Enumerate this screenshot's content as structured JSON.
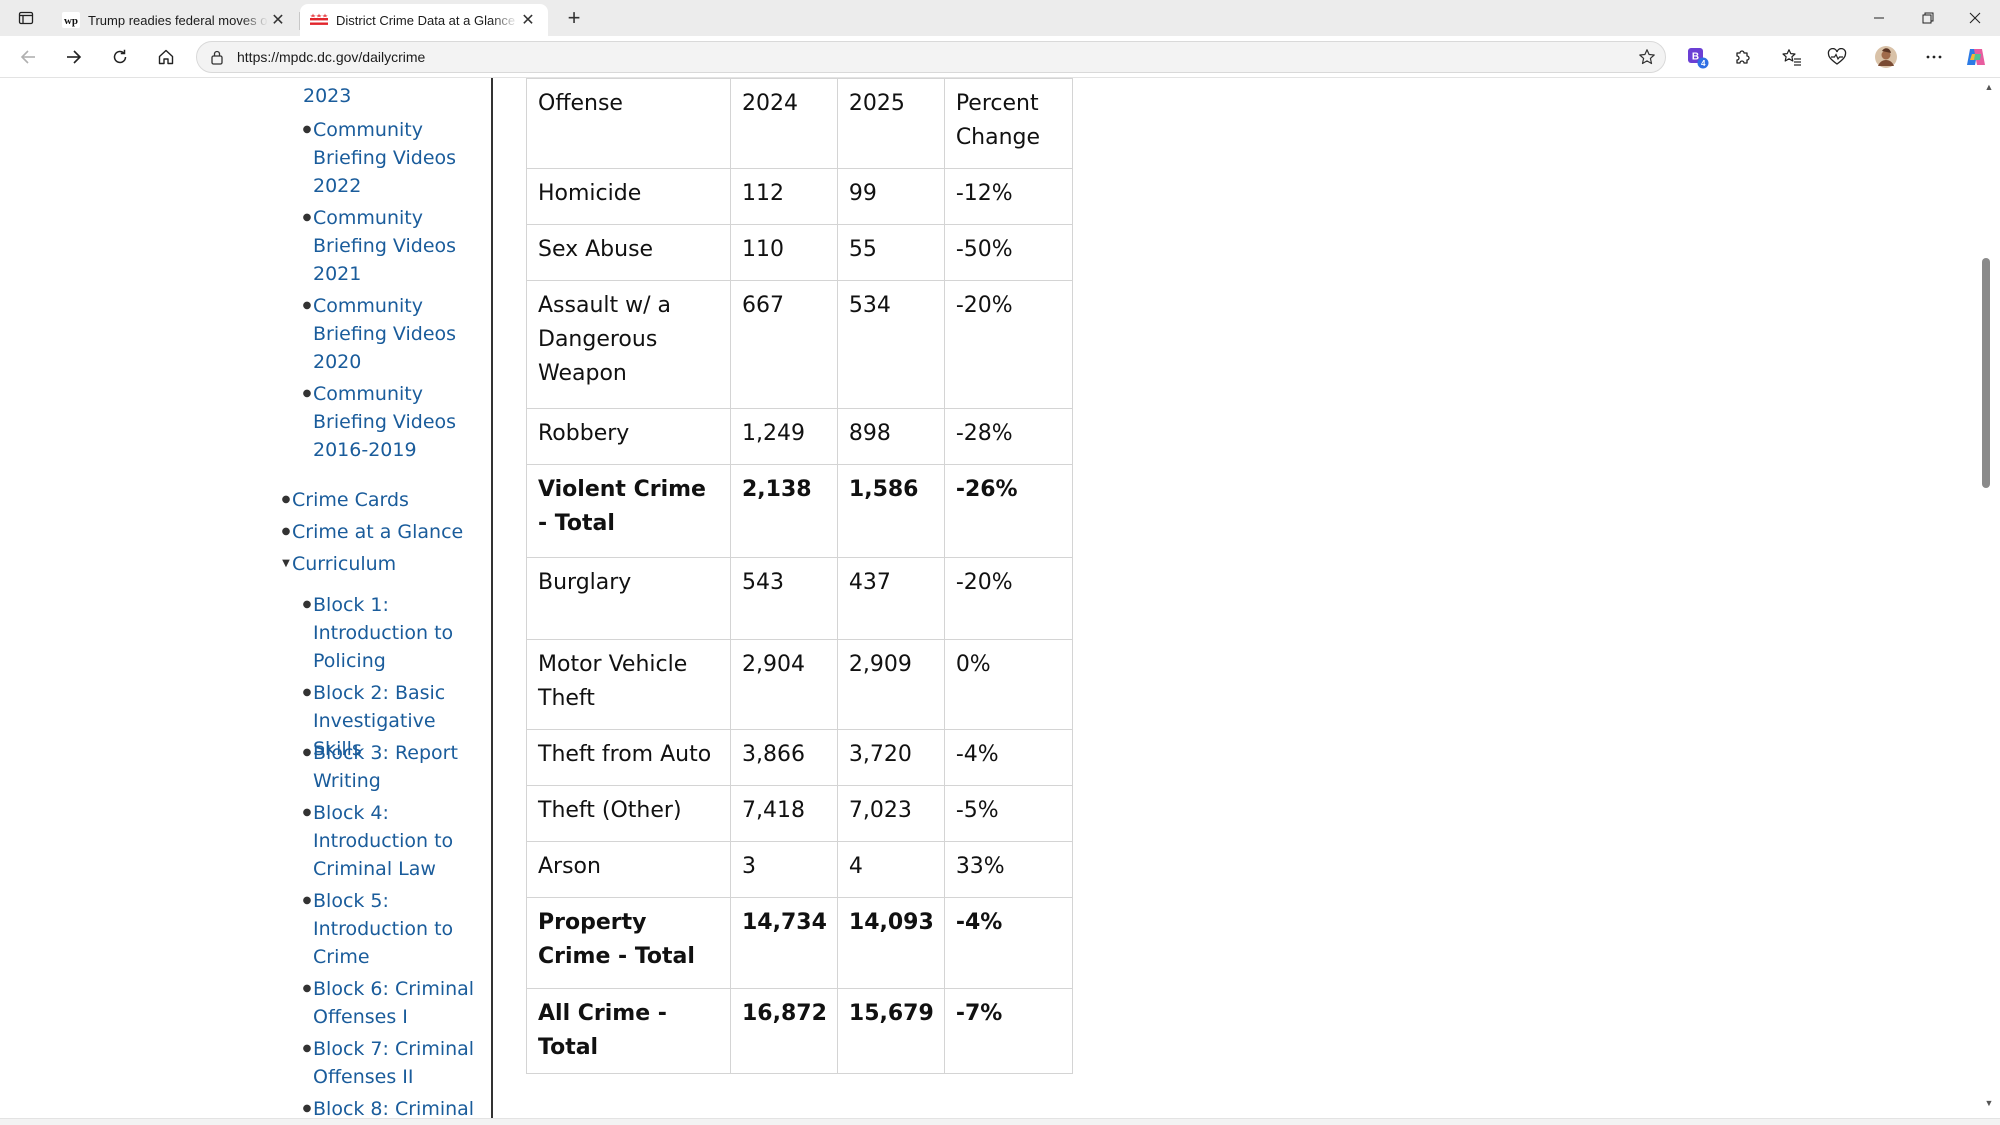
{
  "browser": {
    "tabs": [
      {
        "title": "Trump readies federal moves on D",
        "favicon": "wp-logo-icon",
        "active": false
      },
      {
        "title": "District Crime Data at a Glance | m",
        "favicon": "dc-flag-icon",
        "active": true
      }
    ],
    "url": "https://mpdc.dc.gov/dailycrime",
    "extension_badge": "4"
  },
  "sidebar": {
    "items": [
      {
        "label": "2023",
        "level": "sub",
        "partial": true
      },
      {
        "label": "Community Briefing Videos 2022",
        "level": "sub"
      },
      {
        "label": "Community Briefing Videos 2021",
        "level": "sub"
      },
      {
        "label": "Community Briefing Videos 2020",
        "level": "sub"
      },
      {
        "label": "Community Briefing Videos 2016-2019",
        "level": "sub"
      },
      {
        "label": "Crime Cards",
        "level": "top"
      },
      {
        "label": "Crime at a Glance",
        "level": "top"
      },
      {
        "label": "Curriculum",
        "level": "top",
        "expanded": true
      },
      {
        "label": "Block 1: Introduction to Policing",
        "level": "sub"
      },
      {
        "label": "Block 2: Basic Investigative Skills",
        "level": "sub"
      },
      {
        "label": "Block 3: Report Writing",
        "level": "sub"
      },
      {
        "label": "Block 4: Introduction to Criminal Law",
        "level": "sub"
      },
      {
        "label": "Block 5: Introduction to Crime",
        "level": "sub"
      },
      {
        "label": "Block 6: Criminal Offenses I",
        "level": "sub"
      },
      {
        "label": "Block 7: Criminal Offenses II",
        "level": "sub"
      },
      {
        "label": "Block 8: Criminal",
        "level": "sub",
        "partial": true
      }
    ]
  },
  "crime_table": {
    "headers": [
      "Offense",
      "2024",
      "2025",
      "Percent Change"
    ],
    "rows": [
      {
        "cells": [
          "Homicide",
          "112",
          "99",
          "-12%"
        ],
        "bold": false
      },
      {
        "cells": [
          "Sex Abuse",
          "110",
          "55",
          "-50%"
        ],
        "bold": false
      },
      {
        "cells": [
          "Assault w/ a Dangerous Weapon",
          "667",
          "534",
          "-20%"
        ],
        "bold": false
      },
      {
        "cells": [
          "Robbery",
          "1,249",
          "898",
          "-28%"
        ],
        "bold": false
      },
      {
        "cells": [
          "Violent Crime - Total",
          "2,138",
          "1,586",
          "-26%"
        ],
        "bold": true
      },
      {
        "cells": [
          "Burglary",
          "543",
          "437",
          "-20%"
        ],
        "bold": false
      },
      {
        "cells": [
          "Motor Vehicle Theft",
          "2,904",
          "2,909",
          "0%"
        ],
        "bold": false
      },
      {
        "cells": [
          "Theft from Auto",
          "3,866",
          "3,720",
          "-4%"
        ],
        "bold": false
      },
      {
        "cells": [
          "Theft (Other)",
          "7,418",
          "7,023",
          "-5%"
        ],
        "bold": false
      },
      {
        "cells": [
          "Arson",
          "3",
          "4",
          "33%"
        ],
        "bold": false
      },
      {
        "cells": [
          "Property Crime - Total",
          "14,734",
          "14,093",
          "-4%"
        ],
        "bold": true
      },
      {
        "cells": [
          "All Crime - Total",
          "16,872",
          "15,679",
          "-7%"
        ],
        "bold": true
      }
    ]
  },
  "colors": {
    "link": "#1a5c9b",
    "tabstrip": "#ececec",
    "table_border": "#d4d4d4"
  }
}
